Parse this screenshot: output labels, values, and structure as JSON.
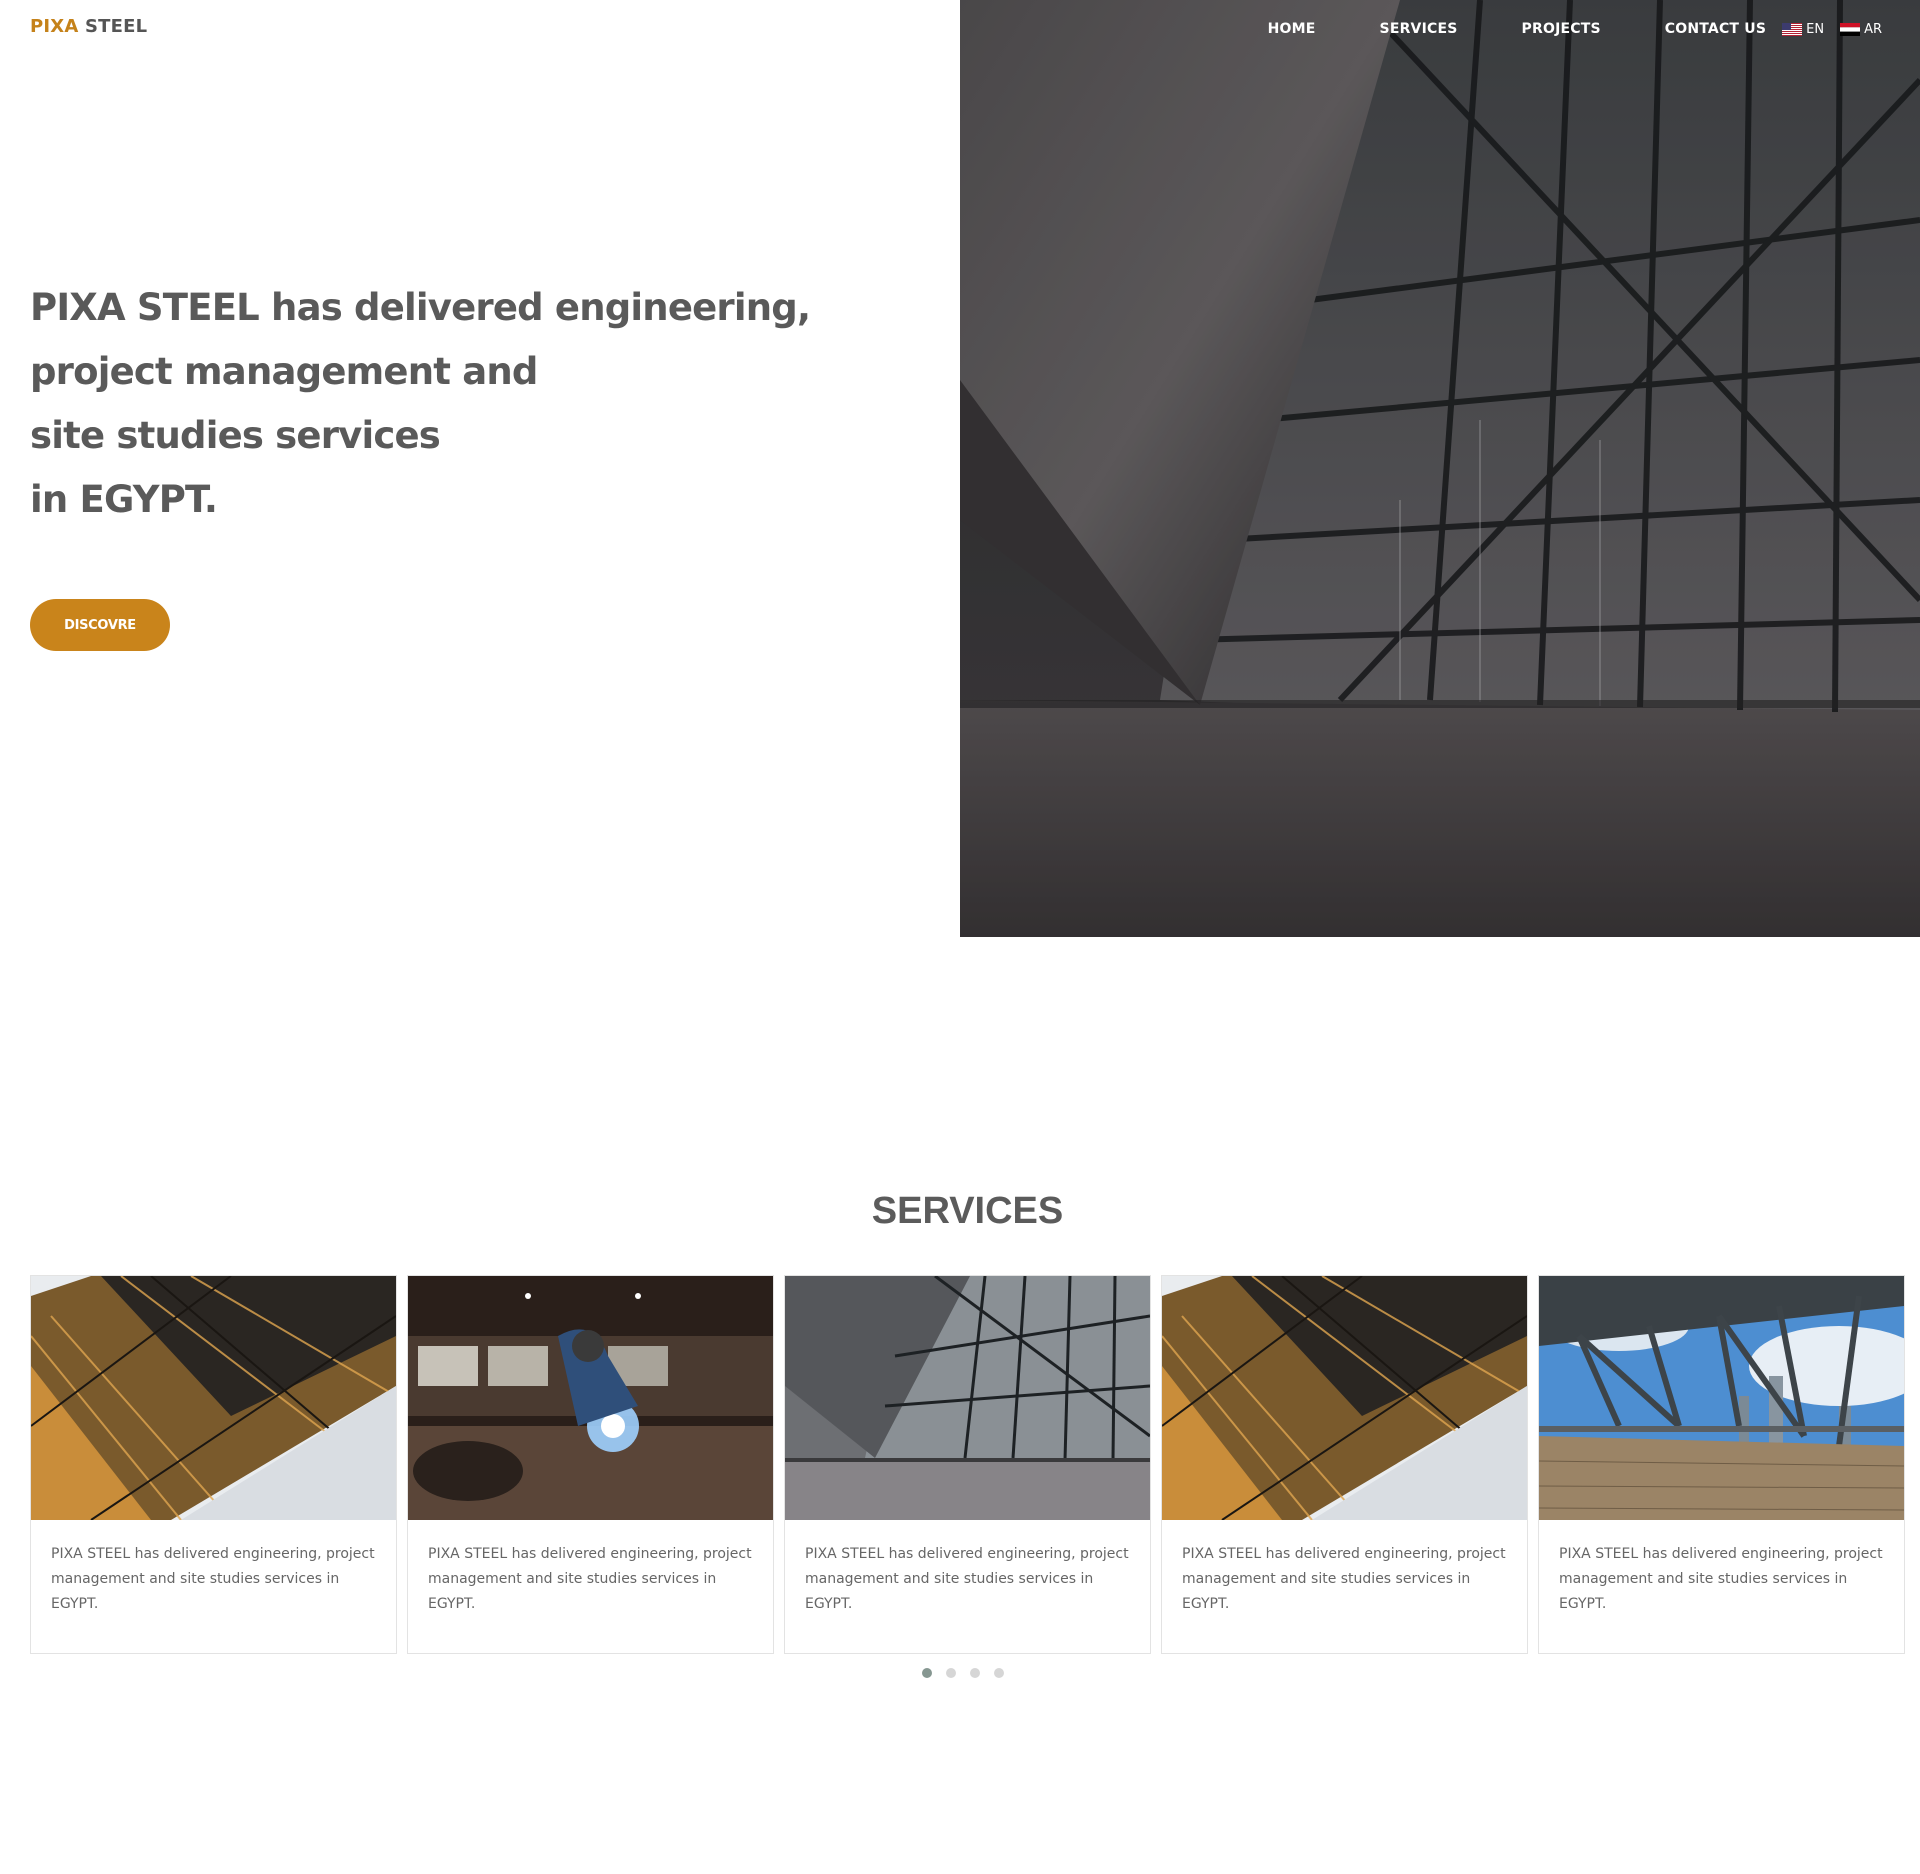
{
  "header": {
    "logo_part1": "PIXA",
    "logo_part2": " STEEL",
    "nav": [
      "HOME",
      "SERVICES",
      "PROJECTS",
      "CONTACT US"
    ],
    "languages": [
      {
        "code": "EN",
        "icon": "us-flag-icon"
      },
      {
        "code": "AR",
        "icon": "egypt-flag-icon"
      }
    ]
  },
  "hero": {
    "lines": [
      "PIXA STEEL has delivered engineering,",
      "project management and",
      "site studies services",
      "in EGYPT."
    ],
    "button": "DISCOVRE"
  },
  "services": {
    "title": "SERVICES",
    "cards": [
      {
        "text": "PIXA STEEL has delivered engineering, project management and site studies services in EGYPT.",
        "image": "glass-skyscrapers-photo"
      },
      {
        "text": "PIXA STEEL has delivered engineering, project management and site studies services in EGYPT.",
        "image": "welder-workshop-photo"
      },
      {
        "text": "PIXA STEEL has delivered engineering, project management and site studies services in EGYPT.",
        "image": "steel-glass-building-photo"
      },
      {
        "text": "PIXA STEEL has delivered engineering, project management and site studies services in EGYPT.",
        "image": "glass-skyscrapers-photo"
      },
      {
        "text": "PIXA STEEL has delivered engineering, project management and site studies services in EGYPT.",
        "image": "steel-bridge-photo"
      }
    ],
    "carousel_pages": 4,
    "active_page": 1
  },
  "colors": {
    "accent": "#c9841b",
    "text": "#5a5a5a",
    "dot_active": "#869791",
    "dot_inactive": "#d6d6d6"
  }
}
